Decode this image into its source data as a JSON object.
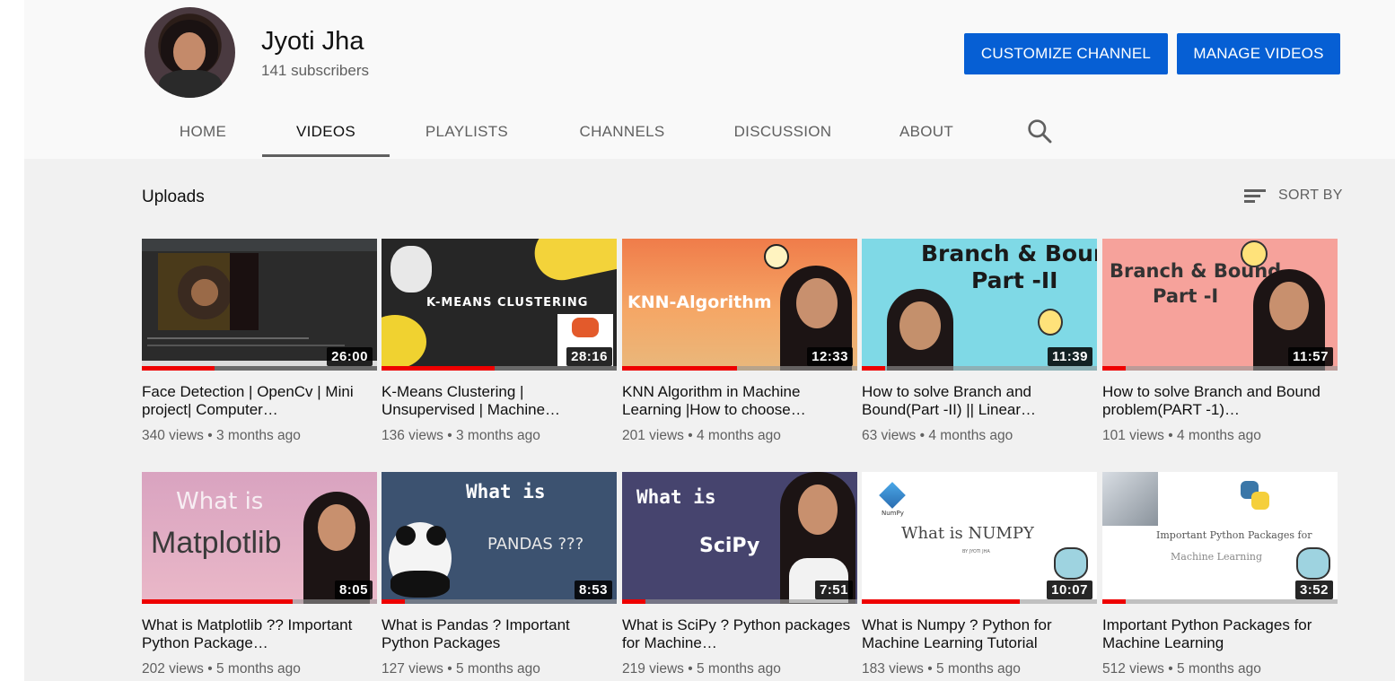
{
  "channel": {
    "name": "Jyoti Jha",
    "subscribers": "141 subscribers",
    "customize_label": "CUSTOMIZE CHANNEL",
    "manage_label": "MANAGE VIDEOS"
  },
  "tabs": [
    {
      "label": "HOME"
    },
    {
      "label": "VIDEOS"
    },
    {
      "label": "PLAYLISTS"
    },
    {
      "label": "CHANNELS"
    },
    {
      "label": "DISCUSSION"
    },
    {
      "label": "ABOUT"
    }
  ],
  "search_icon": "search-icon",
  "section": {
    "title": "Uploads",
    "sort_label": "SORT BY"
  },
  "colors": {
    "accent": "#065fd4",
    "progress": "#ee0000"
  },
  "videos": [
    {
      "title": "Face Detection | OpenCv | Mini project| Computer…",
      "views": "340 views",
      "age": "3 months ago",
      "duration": "26:00",
      "progress": 0.31
    },
    {
      "title": "K-Means Clustering | Unsupervised | Machine…",
      "views": "136 views",
      "age": "3 months ago",
      "duration": "28:16",
      "progress": 0.48,
      "thumb_text": "K-MEANS CLUSTERING"
    },
    {
      "title": "KNN Algorithm in Machine Learning |How to choose…",
      "views": "201 views",
      "age": "4 months ago",
      "duration": "12:33",
      "progress": 0.49,
      "thumb_text": "KNN-Algorithm"
    },
    {
      "title": "How to solve Branch and Bound(Part -II) || Linear…",
      "views": "63 views",
      "age": "4 months ago",
      "duration": "11:39",
      "progress": 0.1,
      "thumb_text": "Branch & Bound",
      "thumb_text2": "Part -II"
    },
    {
      "title": "How to solve Branch and Bound problem(PART -1)…",
      "views": "101 views",
      "age": "4 months ago",
      "duration": "11:57",
      "progress": 0.1,
      "thumb_text": "Branch & Bound",
      "thumb_text2": "Part -I"
    },
    {
      "title": "What is Matplotlib ?? Important Python Package…",
      "views": "202 views",
      "age": "5 months ago",
      "duration": "8:05",
      "progress": 0.64,
      "thumb_text": "What is",
      "thumb_text2": "Matplotlib"
    },
    {
      "title": "What is Pandas ? Important Python Packages",
      "views": "127 views",
      "age": "5 months ago",
      "duration": "8:53",
      "progress": 0.1,
      "thumb_text": "What is",
      "thumb_text2": "PANDAS ???"
    },
    {
      "title": "What is SciPy ? Python packages for Machine…",
      "views": "219 views",
      "age": "5 months ago",
      "duration": "7:51",
      "progress": 0.1,
      "thumb_text": "What is",
      "thumb_text2": "SciPy"
    },
    {
      "title": "What is Numpy ? Python for Machine Learning Tutorial",
      "views": "183 views",
      "age": "5 months ago",
      "duration": "10:07",
      "progress": 0.67,
      "thumb_text": "What is NUMPY",
      "thumb_text2": "BY JYOTI JHA",
      "thumb_text3": "NumPy"
    },
    {
      "title": "Important Python Packages for Machine Learning",
      "views": "512 views",
      "age": "5 months ago",
      "duration": "3:52",
      "progress": 0.1,
      "thumb_text": "Important Python Packages for",
      "thumb_text2": "Machine Learning"
    }
  ]
}
